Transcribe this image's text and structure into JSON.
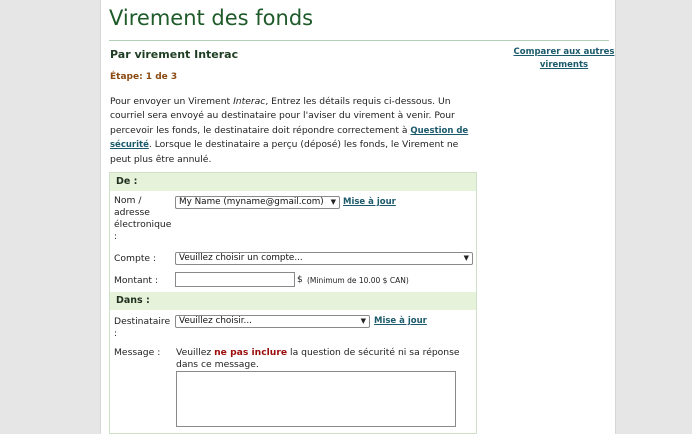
{
  "page": {
    "title": "Virement des fonds",
    "subtitle": "Par virement Interac",
    "compare_link": "Comparer aux autres virements",
    "step": "Étape: 1 de 3",
    "intro": {
      "part1": "Pour envoyer un Virement ",
      "italic": "Interac",
      "part2": ", Entrez les détails requis ci-dessous. Un courriel sera envoyé au destinataire pour l'aviser du virement à venir. Pour percevoir les fonds, le destinataire doit répondre correctement à ",
      "link": "Question de sécurité",
      "part3": ". Lorsque le destinataire a perçu (déposé) les fonds, le Virement ne peut plus être annulé."
    }
  },
  "form": {
    "from_section": "De :",
    "name_label": "Nom / adresse électronique :",
    "name_value": "My Name (myname@gmail.com)",
    "update_link": "Mise à jour",
    "account_label": "Compte :",
    "account_value": "Veuillez choisir un compte...",
    "amount_label": "Montant :",
    "amount_value": "",
    "currency": "$",
    "amount_hint": "(Minimum de 10.00 $ CAN)",
    "to_section": "Dans :",
    "recipient_label": "Destinataire :",
    "recipient_value": "Veuillez choisir...",
    "recipient_update_link": "Mise à jour",
    "message_label": "Message :",
    "message_prefix": "Veuillez ",
    "message_warn": "ne pas inclure",
    "message_suffix": " la question de sécurité ni sa réponse dans ce message.",
    "message_value": ""
  }
}
